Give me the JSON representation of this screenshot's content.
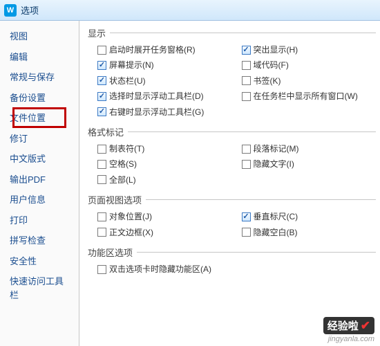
{
  "window": {
    "icon_letter": "W",
    "title": "选项"
  },
  "sidebar": {
    "items": [
      {
        "label": "视图"
      },
      {
        "label": "编辑"
      },
      {
        "label": "常规与保存"
      },
      {
        "label": "备份设置"
      },
      {
        "label": "文件位置"
      },
      {
        "label": "修订"
      },
      {
        "label": "中文版式"
      },
      {
        "label": "输出PDF"
      },
      {
        "label": "用户信息"
      },
      {
        "label": "打印"
      },
      {
        "label": "拼写检查"
      },
      {
        "label": "安全性"
      },
      {
        "label": "快速访问工具栏"
      }
    ],
    "highlighted_index": 3
  },
  "groups": {
    "display": {
      "title": "显示",
      "left": [
        {
          "label": "启动时展开任务窗格(R)",
          "checked": false
        },
        {
          "label": "屏幕提示(N)",
          "checked": true
        },
        {
          "label": "状态栏(U)",
          "checked": true
        },
        {
          "label": "选择时显示浮动工具栏(D)",
          "checked": true
        },
        {
          "label": "右键时显示浮动工具栏(G)",
          "checked": true
        }
      ],
      "right": [
        {
          "label": "突出显示(H)",
          "checked": true
        },
        {
          "label": "域代码(F)",
          "checked": false
        },
        {
          "label": "书签(K)",
          "checked": false
        },
        {
          "label": "在任务栏中显示所有窗口(W)",
          "checked": false
        }
      ]
    },
    "format_marks": {
      "title": "格式标记",
      "left": [
        {
          "label": "制表符(T)",
          "checked": false
        },
        {
          "label": "空格(S)",
          "checked": false
        },
        {
          "label": "全部(L)",
          "checked": false
        }
      ],
      "right": [
        {
          "label": "段落标记(M)",
          "checked": false
        },
        {
          "label": "隐藏文字(I)",
          "checked": false
        }
      ]
    },
    "page_view": {
      "title": "页面视图选项",
      "left": [
        {
          "label": "对象位置(J)",
          "checked": false
        },
        {
          "label": "正文边框(X)",
          "checked": false
        }
      ],
      "right": [
        {
          "label": "垂直标尺(C)",
          "checked": true
        },
        {
          "label": "隐藏空白(B)",
          "checked": false
        }
      ]
    },
    "ribbon": {
      "title": "功能区选项",
      "items": [
        {
          "label": "双击选项卡时隐藏功能区(A)",
          "checked": false
        }
      ]
    }
  },
  "watermark": {
    "badge": "经验啦",
    "url": "jingyanla.com"
  }
}
